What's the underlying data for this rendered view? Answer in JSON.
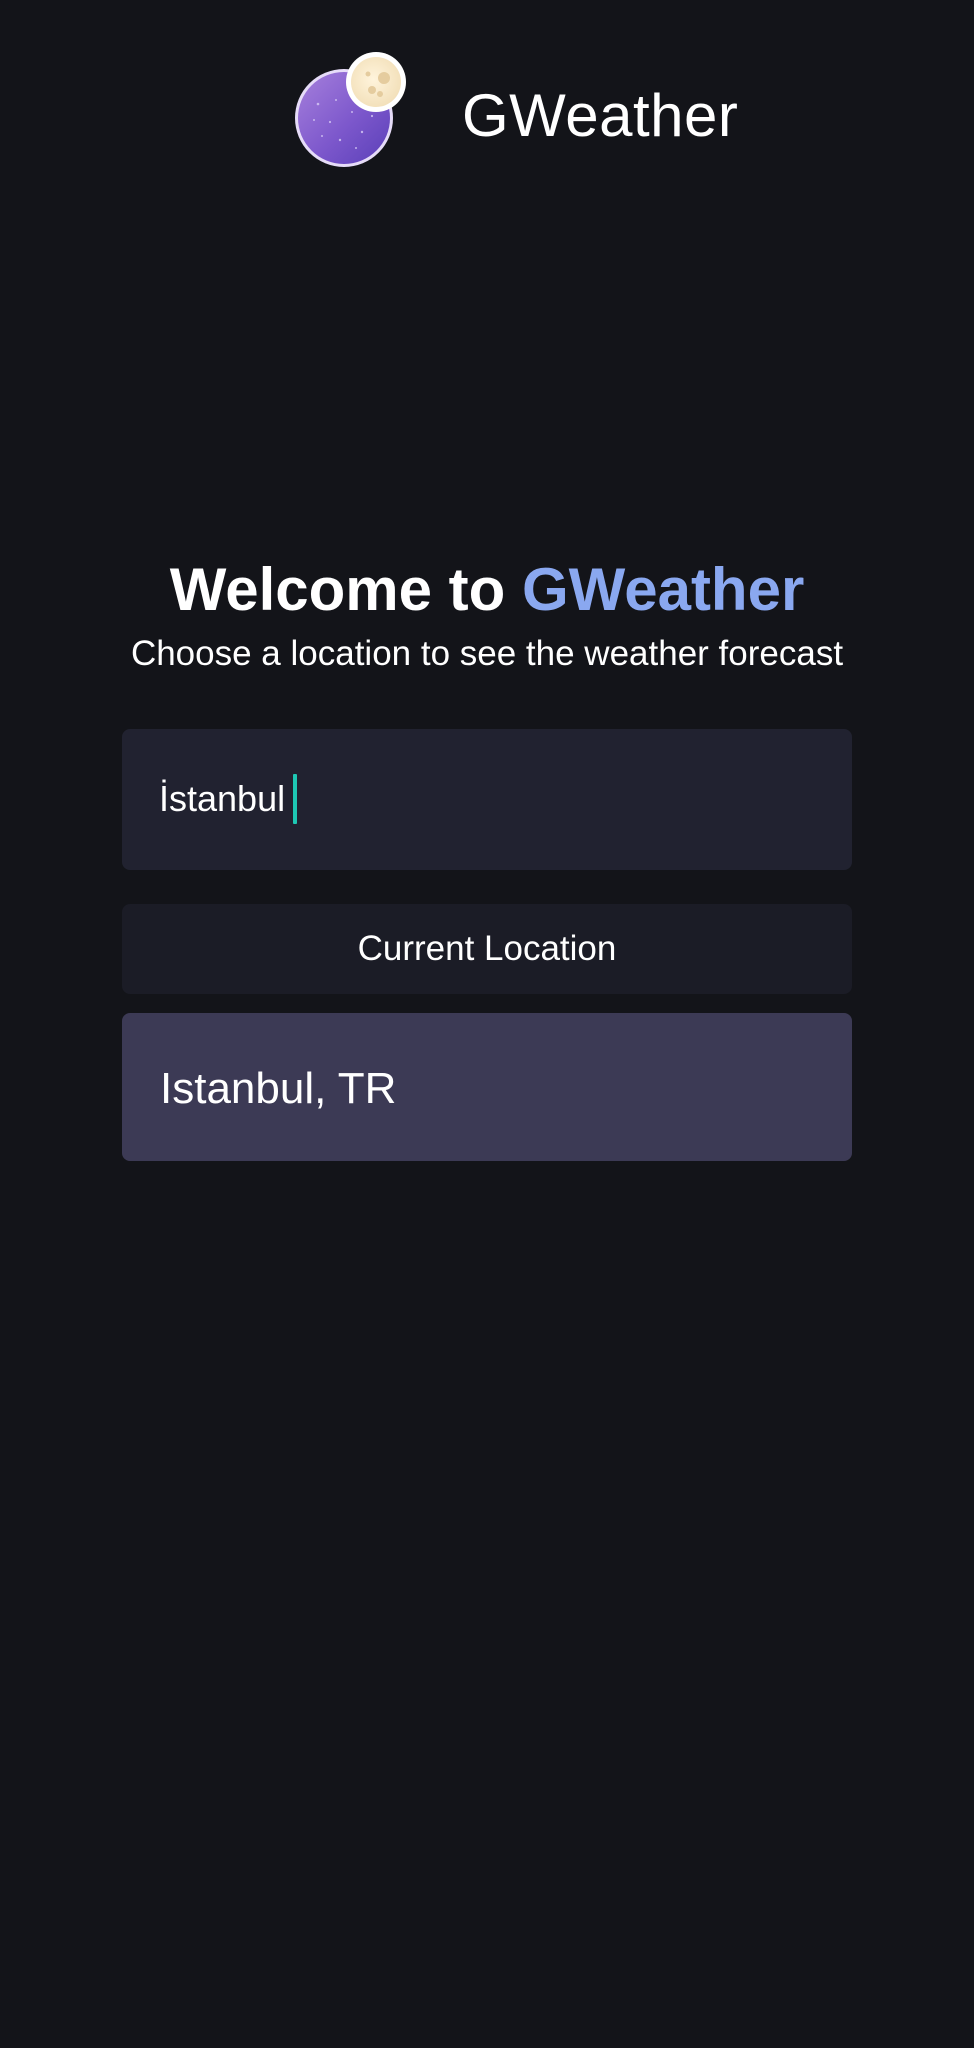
{
  "header": {
    "app_name": "GWeather",
    "logo_icon": "moon-night-globe-icon"
  },
  "welcome": {
    "title_prefix": "Welcome to ",
    "title_accent": "GWeather",
    "subtitle": "Choose a location to see the weather forecast"
  },
  "search": {
    "value": "İstanbul"
  },
  "current_location": {
    "label": "Current Location"
  },
  "results": [
    {
      "label": "Istanbul, TR"
    }
  ],
  "colors": {
    "background": "#131419",
    "accent": "#8aa8f0",
    "caret": "#1ec8b4",
    "search_bg": "#212230",
    "button_bg": "#1b1c26",
    "result_bg": "#3c3a55"
  }
}
